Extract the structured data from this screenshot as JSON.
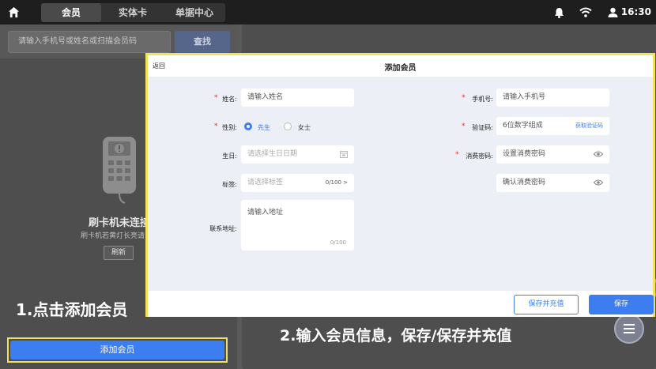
{
  "topbar": {
    "tabs": [
      {
        "label": "会员",
        "active": true
      },
      {
        "label": "实体卡",
        "active": false
      },
      {
        "label": "单据中心",
        "active": false
      }
    ],
    "time": "16:30"
  },
  "left_panel": {
    "search_placeholder": "请输入手机号或姓名或扫描会员码",
    "search_button": "查找",
    "status_title": "刷卡机未连接",
    "status_subtitle": "刷卡机若黄灯长亮请",
    "refresh_button": "刷新",
    "add_member_button": "添加会员"
  },
  "annotations": {
    "step1": "1.点击添加会员",
    "step2": "2.输入会员信息，保存/保存并充值"
  },
  "dialog": {
    "back": "返回",
    "title": "添加会员",
    "fields": {
      "name_label": "姓名:",
      "name_placeholder": "请输入姓名",
      "gender_label": "性别:",
      "gender_options": [
        "先生",
        "女士"
      ],
      "gender_selected": "先生",
      "birthday_label": "生日:",
      "birthday_placeholder": "请选择生日日期",
      "tags_label": "标签:",
      "tags_placeholder": "请选择标签",
      "tags_count": "0/100 >",
      "address_label": "联系地址:",
      "address_placeholder": "请输入地址",
      "address_count": "0/100",
      "phone_label": "手机号:",
      "phone_placeholder": "请输入手机号",
      "code_label": "验证码:",
      "code_placeholder": "6位数字组成",
      "code_link": "获取验证码",
      "pwd_label": "消费密码:",
      "pwd_placeholder": "设置消费密码",
      "pwd_confirm_placeholder": "确认消费密码",
      "required_mark": "*"
    },
    "save_and_recharge": "保存并充值",
    "save": "保存"
  },
  "colors": {
    "accent": "#3c7ef0",
    "highlight": "#f2e25a",
    "required": "#e03030"
  }
}
